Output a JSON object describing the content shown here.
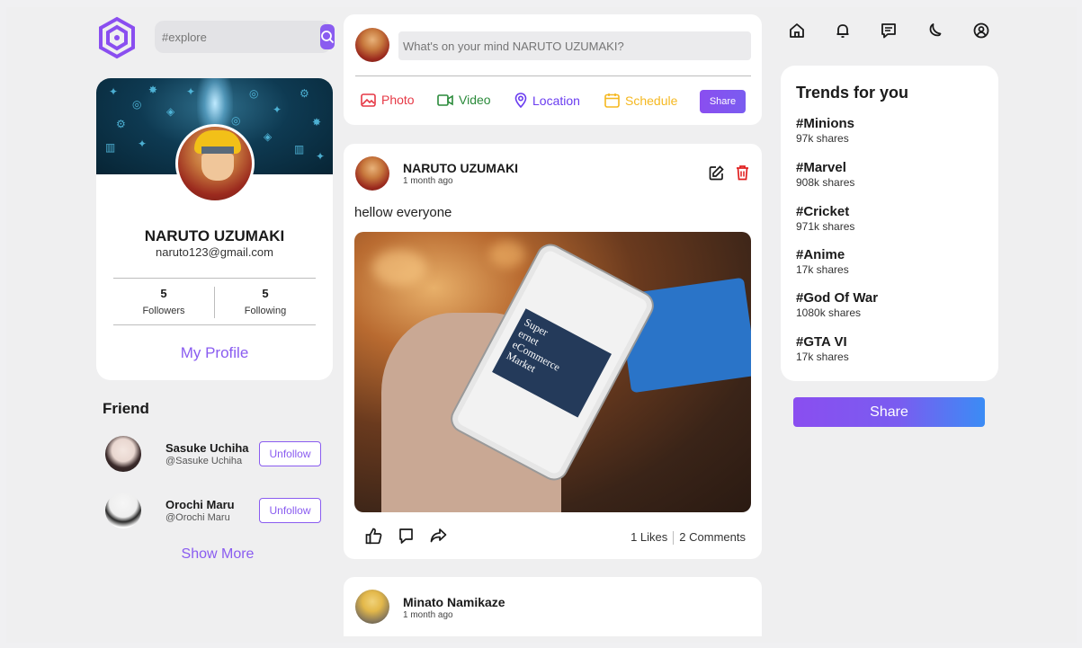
{
  "search": {
    "placeholder": "#explore"
  },
  "profile": {
    "name": "NARUTO UZUMAKI",
    "email": "naruto123@gmail.com",
    "followers_count": "5",
    "followers_label": "Followers",
    "following_count": "5",
    "following_label": "Following",
    "my_profile_label": "My Profile"
  },
  "friends": {
    "title": "Friend",
    "items": [
      {
        "name": "Sasuke Uchiha",
        "handle": "@Sasuke Uchiha",
        "action": "Unfollow"
      },
      {
        "name": "Orochi Maru",
        "handle": "@Orochi Maru",
        "action": "Unfollow"
      }
    ],
    "show_more": "Show More"
  },
  "composer": {
    "placeholder": "What's on your mind NARUTO UZUMAKI?",
    "options": [
      {
        "label": "Photo",
        "icon": "photo-icon",
        "color": "#e63946"
      },
      {
        "label": "Video",
        "icon": "video-icon",
        "color": "#2a8a3a"
      },
      {
        "label": "Location",
        "icon": "location-icon",
        "color": "#6a3cf0"
      },
      {
        "label": "Schedule",
        "icon": "calendar-icon",
        "color": "#f5b820"
      }
    ],
    "share_label": "Share"
  },
  "post": {
    "author": "NARUTO UZUMAKI",
    "time": "1 month ago",
    "text": "hellow everyone",
    "image_screen_text": [
      "Super",
      "ernet",
      "eCommerce",
      "Market"
    ],
    "likes": "1 Likes",
    "comments": "2 Comments"
  },
  "post2": {
    "author": "Minato Namikaze",
    "time": "1 month ago"
  },
  "trends": {
    "title": "Trends for you",
    "items": [
      {
        "tag": "#Minions",
        "shares": "97k shares"
      },
      {
        "tag": "#Marvel",
        "shares": "908k shares"
      },
      {
        "tag": "#Cricket",
        "shares": "971k shares"
      },
      {
        "tag": "#Anime",
        "shares": "17k shares"
      },
      {
        "tag": "#God Of War",
        "shares": "1080k shares"
      },
      {
        "tag": "#GTA VI",
        "shares": "17k shares"
      }
    ]
  },
  "share_button": "Share",
  "colors": {
    "accent": "#8a5cf0",
    "delete": "#e01e1e"
  }
}
